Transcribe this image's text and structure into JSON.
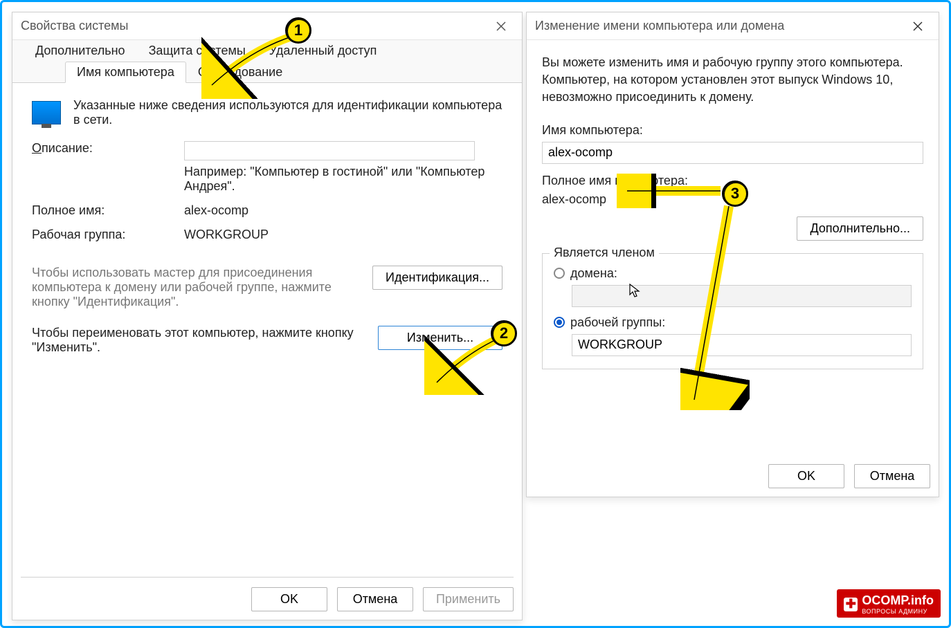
{
  "left": {
    "title": "Свойства системы",
    "tabs_top": [
      "Дополнительно",
      "Защита системы",
      "Удаленный доступ"
    ],
    "tabs_bottom": [
      "Имя компьютера",
      "Оборудование"
    ],
    "desc_text": "Указанные ниже сведения используются для идентификации компьютера в сети.",
    "description_label": "Описание:",
    "description_underline": "О",
    "description_rest": "писание:",
    "description_value": "",
    "hint": "Например: \"Компьютер в гостиной\" или \"Компьютер Андрея\".",
    "full_name_label": "Полное имя:",
    "full_name_value": "alex-ocomp",
    "workgroup_label": "Рабочая группа:",
    "workgroup_value": "WORKGROUP",
    "wizard_note": "Чтобы использовать мастер для присоединения компьютера к домену или рабочей группе, нажмите кнопку \"Идентификация\".",
    "identify_btn": "Идентификация...",
    "rename_note": "Чтобы переименовать этот компьютер, нажмите кнопку \"Изменить\".",
    "change_btn": "Изменить...",
    "ok": "OK",
    "cancel": "Отмена",
    "apply": "Применить"
  },
  "right": {
    "title": "Изменение имени компьютера или домена",
    "intro": "Вы можете изменить имя и рабочую группу этого компьютера. Компьютер, на котором установлен этот выпуск Windows 10, невозможно присоединить к домену.",
    "name_label": "Имя компьютера:",
    "name_value": "alex-ocomp",
    "full_label": "Полное имя компьютера:",
    "full_value": "alex-ocomp",
    "advanced_btn": "Дополнительно...",
    "member_legend": "Является членом",
    "radio_domain": "домена:",
    "domain_value": "",
    "radio_workgroup": "рабочей группы:",
    "workgroup_value": "WORKGROUP",
    "ok": "OK",
    "cancel": "Отмена"
  },
  "callouts": {
    "one": "1",
    "two": "2",
    "three": "3"
  },
  "watermark": {
    "main": "OCOMP.info",
    "sub": "ВОПРОСЫ АДМИНУ"
  }
}
